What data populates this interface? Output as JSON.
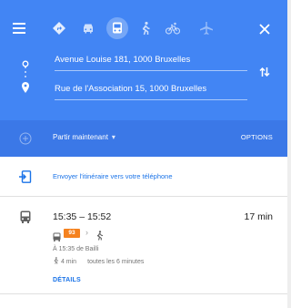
{
  "colors": {
    "header": "#4285f4",
    "subheader": "#3b78e7",
    "link": "#1a73e8",
    "bus_badge": "#f5821f"
  },
  "toolbar": {
    "menu_icon": "menu-icon",
    "modes": [
      "best-route-icon",
      "car-icon",
      "transit-icon",
      "walking-icon",
      "cycling-icon",
      "flight-icon"
    ],
    "selected_mode": "transit-icon",
    "close_icon": "close-icon"
  },
  "directions": {
    "origin": "Avenue Louise 181, 1000 Bruxelles",
    "destination": "Rue de l'Association 15, 1000 Bruxelles",
    "swap_icon": "swap-icon"
  },
  "departure": {
    "label": "Partir maintenant",
    "caret": "▾",
    "options_label": "OPTIONS"
  },
  "send_to_phone": {
    "label": "Envoyer l'itinéraire vers votre téléphone"
  },
  "route": {
    "times": "15:35 – 15:52",
    "duration": "17 min",
    "bus_line": "93",
    "chevron": "›",
    "from_stop": "À 15:35 de Bailli",
    "walk_time": "4 min",
    "frequency": "toutes les 6 minutes",
    "details_label": "DÉTAILS"
  }
}
